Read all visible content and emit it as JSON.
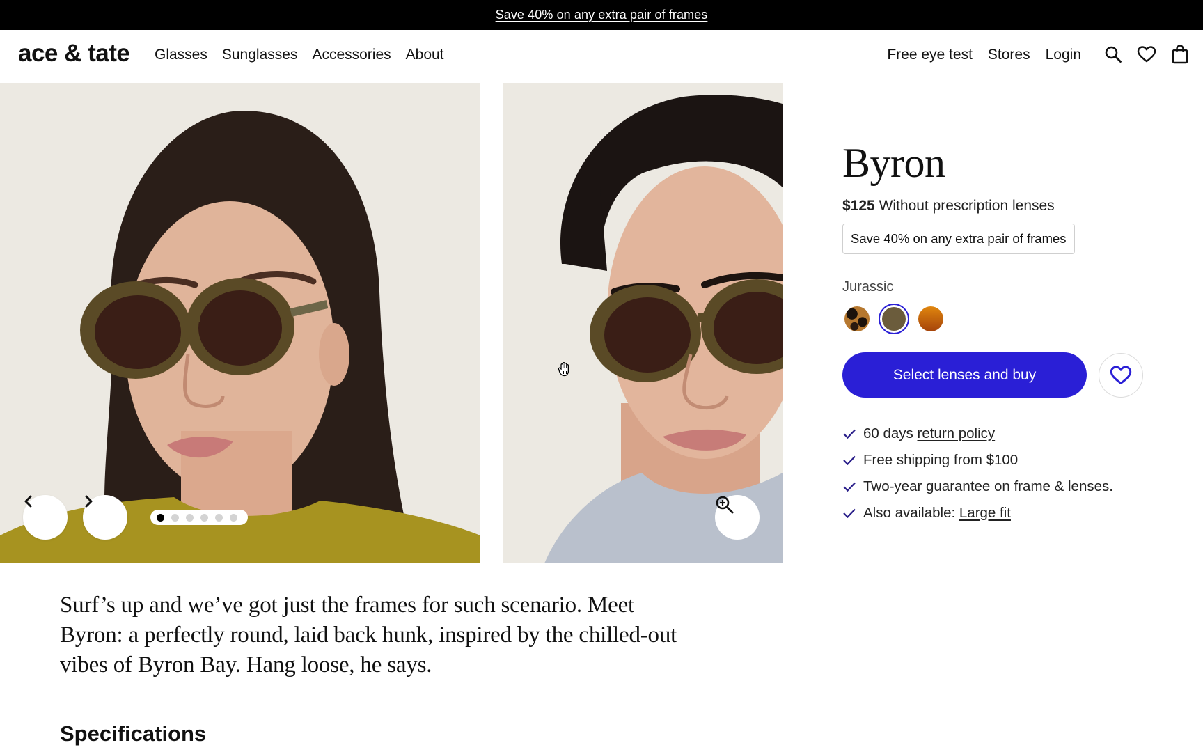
{
  "promo_bar": {
    "text": "Save 40% on any extra pair of frames"
  },
  "header": {
    "logo": "ace & tate",
    "nav_left": [
      "Glasses",
      "Sunglasses",
      "Accessories",
      "About"
    ],
    "nav_right": [
      "Free eye test",
      "Stores",
      "Login"
    ],
    "icons": [
      "search-icon",
      "heart-icon",
      "shopping-bag-icon"
    ]
  },
  "gallery": {
    "images": [
      "woman-wearing-byron-sunglasses",
      "man-wearing-byron-sunglasses"
    ],
    "slide_count": 6,
    "active_slide": 1,
    "controls": [
      "chevron-left-icon",
      "chevron-right-icon",
      "zoom-in-icon"
    ]
  },
  "product": {
    "name": "Byron",
    "price": "$125",
    "price_note": "Without prescription lenses",
    "promo_badge": "Save 40% on any extra pair of frames",
    "selected_color": "Jurassic",
    "swatches": [
      {
        "name": "tortoise",
        "selected": false
      },
      {
        "name": "Jurassic",
        "selected": true,
        "color": "#6b5c3c"
      },
      {
        "name": "amber",
        "selected": false,
        "color": "#c8650c"
      }
    ],
    "buy_label": "Select lenses and buy",
    "accent_color": "#2a1fd6",
    "usps": [
      {
        "text": "60 days ",
        "link": "return policy"
      },
      {
        "text": "Free shipping from $100"
      },
      {
        "text": "Two-year guarantee on frame & lenses."
      },
      {
        "text": "Also available: ",
        "link": "Large fit"
      }
    ]
  },
  "description": "Surf’s up and we’ve got just the frames for such scenario. Meet Byron: a perfectly round, laid back hunk, inspired by the chilled-out vibes of Byron Bay. Hang loose, he says.",
  "specifications": {
    "title": "Specifications"
  }
}
